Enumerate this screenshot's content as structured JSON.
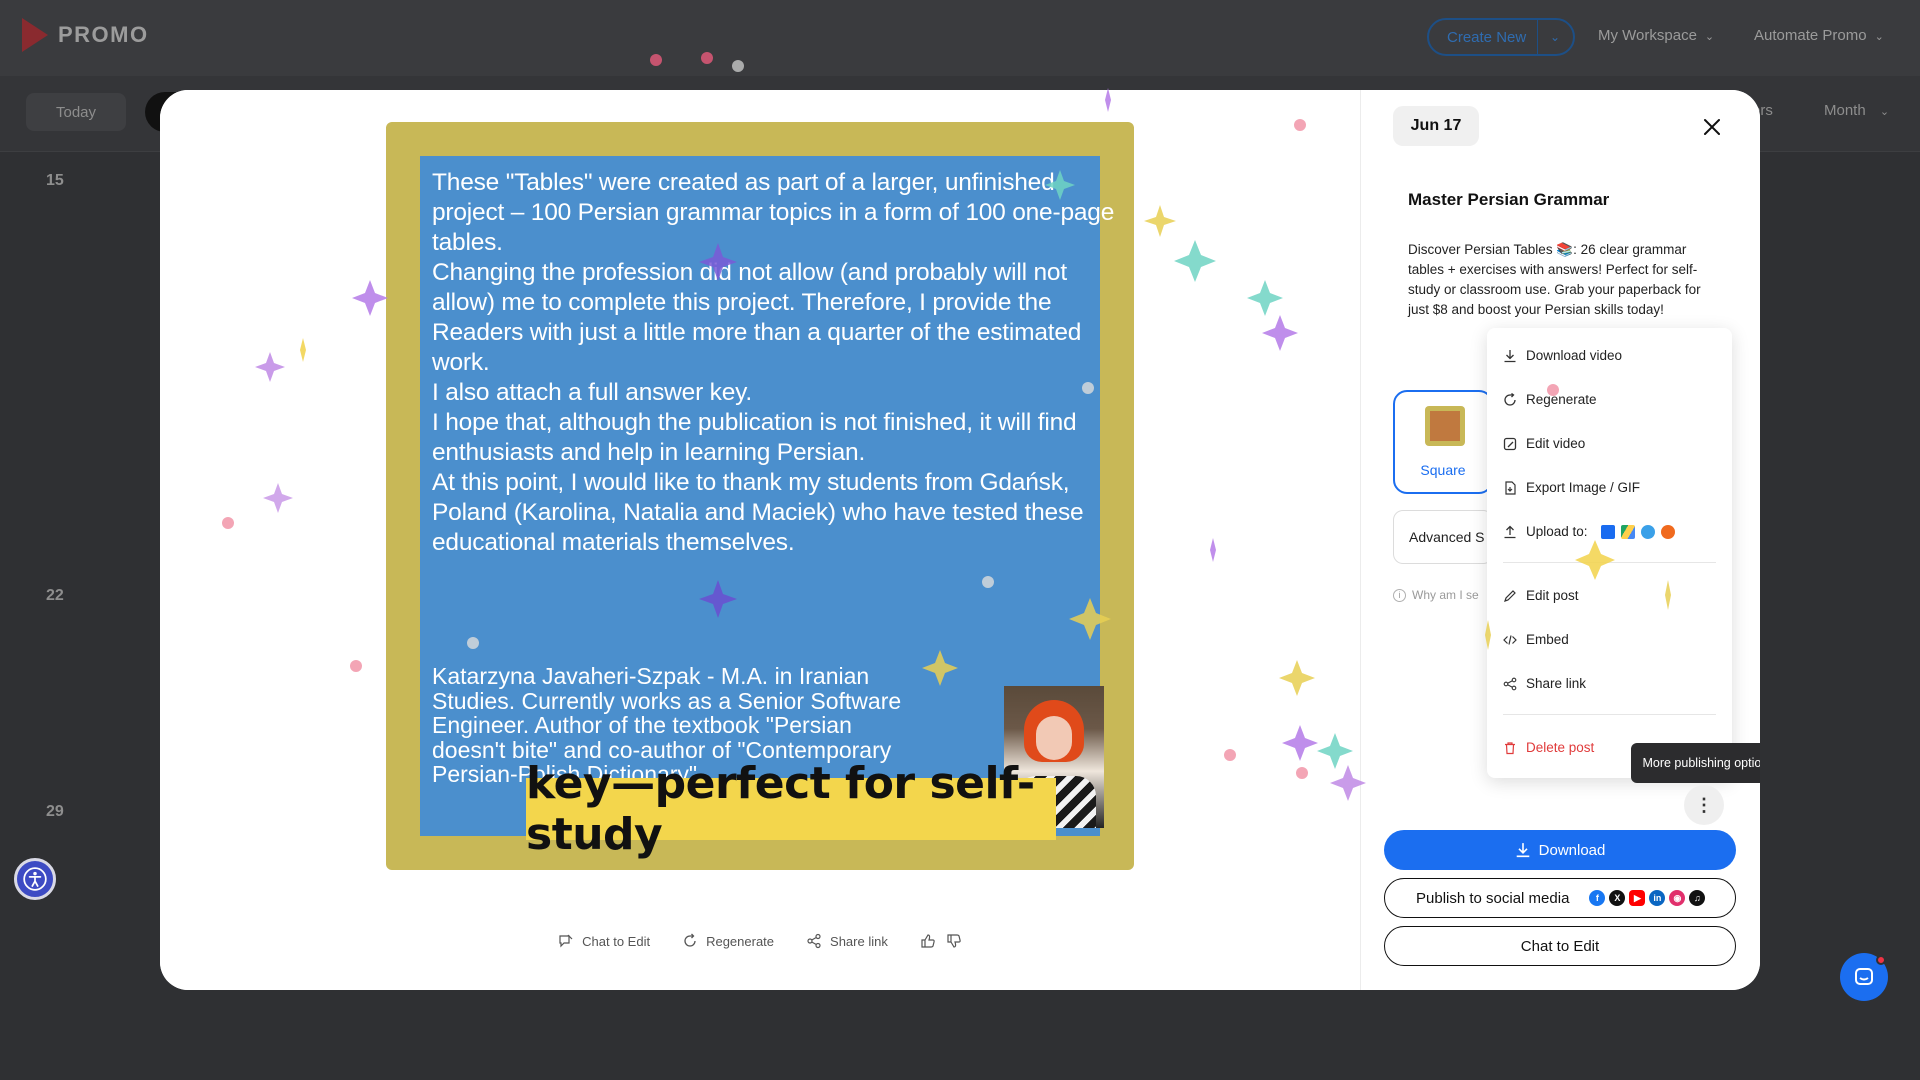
{
  "app": {
    "logo_text": "PROMO",
    "create_new_label": "Create New",
    "my_workspace_label": "My Workspace",
    "automate_label": "Automate Promo"
  },
  "calendar": {
    "today_label": "Today",
    "filters_label_partial": "ers",
    "view_label": "Month",
    "week_numbers": [
      "15",
      "22",
      "29"
    ]
  },
  "video": {
    "paragraphs": [
      "These \"Tables\" were created as part of a larger, unfinished project – 100 Persian grammar topics in a form of 100 one-page tables.",
      "Changing the profession did not allow (and probably will not allow) me to complete this project. Therefore, I provide the Readers with just a little more than a quarter of the estimated work.",
      "I also attach a full answer key.",
      "I hope that, although the publication is not finished, it will find enthusiasts and help in learning Persian.",
      "At this point, I would like to thank my students from Gdańsk, Poland (Karolina, Natalia and Maciek) who have tested these educational materials themselves."
    ],
    "bio": "Katarzyna Javaheri-Szpak - M.A. in Iranian Studies. Currently works as a Senior Software Engineer. Author of the textbook \"Persian doesn't bite\" and co-author of \"Contemporary Persian-Polish Dictionary\"",
    "caption": "key—perfect for self-study"
  },
  "actions": {
    "chat_to_edit": "Chat to Edit",
    "regenerate": "Regenerate",
    "share_link": "Share link"
  },
  "panel": {
    "date": "Jun 17",
    "title": "Master Persian Grammar",
    "description": "Discover Persian Tables 📚: 26 clear grammar tables + exercises with answers! Perfect for self-study or classroom use. Grab your paperback for just $8 and boost your Persian skills today!",
    "format_label": "Square",
    "advanced_label": "Advanced S",
    "why_label": "Why am I se",
    "menu": {
      "download_video": "Download video",
      "regenerate": "Regenerate",
      "edit_video": "Edit video",
      "export_image": "Export Image / GIF",
      "upload_to": "Upload to:",
      "edit_post": "Edit post",
      "embed": "Embed",
      "share_link": "Share link",
      "delete_post": "Delete post"
    },
    "tooltip": "More publishing options",
    "download_label": "Download",
    "publish_label": "Publish to social media",
    "chat_label": "Chat to Edit"
  },
  "colors": {
    "accent": "#1b6ef0",
    "danger": "#e03b3b",
    "video_frame": "#c8b857",
    "video_bg": "#4b8fcd",
    "caption_bg": "#f3d64c"
  }
}
